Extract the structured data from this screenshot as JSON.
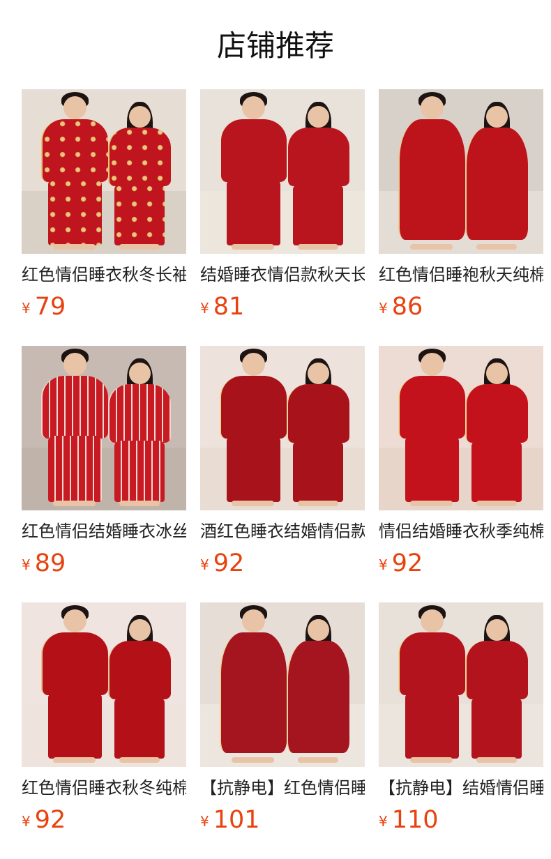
{
  "header": {
    "title": "店铺推荐"
  },
  "products": [
    {
      "title": "红色情侣睡衣秋冬长袖纯棉",
      "currency": "¥",
      "price": "79",
      "scene": {
        "bg": "#e6ded5",
        "floor": "#d9d0c6",
        "outfit": "#c0151e",
        "accent": "#e8c67a",
        "style": "print"
      }
    },
    {
      "title": "结婚睡衣情侣款秋天长袖",
      "currency": "¥",
      "price": "81",
      "scene": {
        "bg": "#e9e2da",
        "floor": "#ece6dd",
        "outfit": "#b8151f",
        "accent": "#f2e3c8",
        "style": "plain"
      }
    },
    {
      "title": "红色情侣睡袍秋天纯棉",
      "currency": "¥",
      "price": "86",
      "scene": {
        "bg": "#d8d1ca",
        "floor": "#e4ddd5",
        "outfit": "#bd141c",
        "accent": "#e6cf9b",
        "style": "robe"
      }
    },
    {
      "title": "红色情侣结婚睡衣冰丝",
      "currency": "¥",
      "price": "89",
      "scene": {
        "bg": "#c6bab2",
        "floor": "#bfb3aa",
        "outfit": "#c81a22",
        "accent": "#f1d8d0",
        "style": "stripe"
      }
    },
    {
      "title": "酒红色睡衣结婚情侣款",
      "currency": "¥",
      "price": "92",
      "scene": {
        "bg": "#ede3dc",
        "floor": "#e8dcd3",
        "outfit": "#a8121b",
        "accent": "#f0d59a",
        "style": "plain"
      }
    },
    {
      "title": "情侣结婚睡衣秋季纯棉",
      "currency": "¥",
      "price": "92",
      "scene": {
        "bg": "#ecdcd3",
        "floor": "#e7d5ca",
        "outfit": "#c4121c",
        "accent": "#f0d59a",
        "style": "plain"
      }
    },
    {
      "title": "红色情侣睡衣秋冬纯棉",
      "currency": "¥",
      "price": "92",
      "scene": {
        "bg": "#f0e4e0",
        "floor": "#efe3de",
        "outfit": "#b41018",
        "accent": "#e6c69a",
        "style": "plain"
      }
    },
    {
      "title": "【抗静电】红色情侣睡衣",
      "currency": "¥",
      "price": "101",
      "scene": {
        "bg": "#e5ddd6",
        "floor": "#ece6df",
        "outfit": "#a51520",
        "accent": "#f0d59a",
        "style": "robe"
      }
    },
    {
      "title": "【抗静电】结婚情侣睡衣",
      "currency": "¥",
      "price": "110",
      "scene": {
        "bg": "#e8e1da",
        "floor": "#ebe5de",
        "outfit": "#b3131d",
        "accent": "#f0d59a",
        "style": "plain"
      }
    }
  ]
}
